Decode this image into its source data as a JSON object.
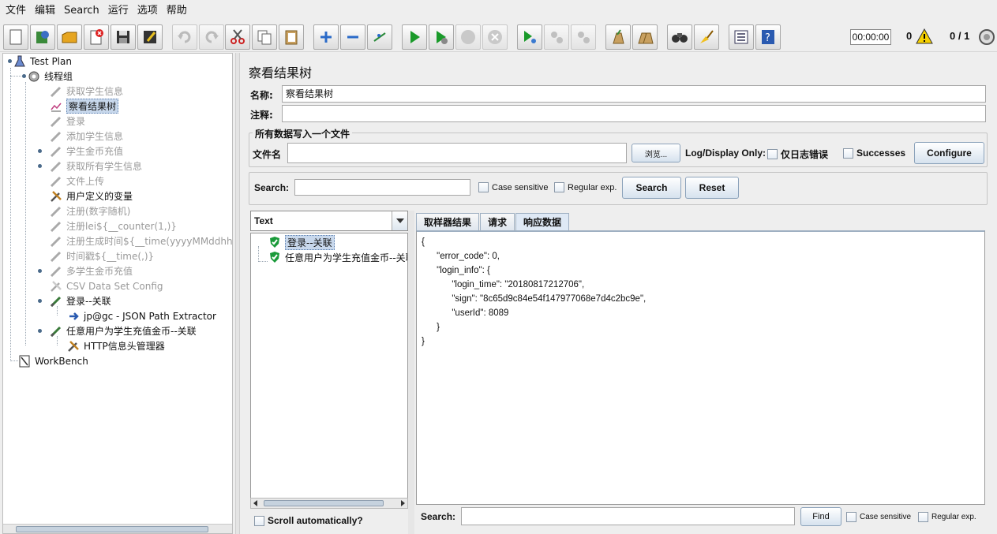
{
  "menubar": [
    "文件",
    "编辑",
    "Search",
    "运行",
    "选项",
    "帮助"
  ],
  "toolbar": {
    "buttons": [
      "new-icon",
      "templates-icon",
      "open-icon",
      "close-icon",
      "save-icon",
      "save-as-icon",
      "undo-icon",
      "redo-icon",
      "cut-icon",
      "copy-icon",
      "paste-icon",
      "expand-icon",
      "collapse-icon",
      "toggle-icon",
      "start-icon",
      "start-no-pause-icon",
      "stop-icon",
      "shutdown-icon",
      "remote-start-icon",
      "remote-stop-icon",
      "remote-shutdown-icon",
      "clear-icon",
      "clear-all-icon",
      "search-icon",
      "reset-search-icon",
      "function-helper-icon",
      "help-icon"
    ],
    "timer": "00:00:00",
    "warning_count": "0",
    "threads": "0 / 1"
  },
  "tree": {
    "items": [
      {
        "label": "Test Plan",
        "icon": "test-plan-icon"
      },
      {
        "label": "线程组",
        "icon": "thread-group-icon"
      },
      {
        "label": "获取学生信息",
        "icon": "sampler-icon"
      },
      {
        "label": "察看结果树",
        "icon": "listener-icon"
      },
      {
        "label": "登录",
        "icon": "sampler-icon"
      },
      {
        "label": "添加学生信息",
        "icon": "sampler-icon"
      },
      {
        "label": "学生金币充值",
        "icon": "sampler-icon"
      },
      {
        "label": "获取所有学生信息",
        "icon": "sampler-icon"
      },
      {
        "label": "文件上传",
        "icon": "sampler-icon"
      },
      {
        "label": "用户定义的变量",
        "icon": "config-icon"
      },
      {
        "label": "注册(数字随机)",
        "icon": "sampler-icon"
      },
      {
        "label": "注册lei${__counter(1,)}",
        "icon": "sampler-icon"
      },
      {
        "label": "注册生成时间${__time(yyyyMMddhhmm",
        "icon": "sampler-icon"
      },
      {
        "label": "时间戳${__time(,)}",
        "icon": "sampler-icon"
      },
      {
        "label": "多学生金币充值",
        "icon": "sampler-icon"
      },
      {
        "label": "CSV Data Set Config",
        "icon": "config-icon"
      },
      {
        "label": "登录--关联",
        "icon": "sampler-icon"
      },
      {
        "label": "jp@gc - JSON Path Extractor",
        "icon": "extractor-icon"
      },
      {
        "label": "任意用户为学生充值金币--关联",
        "icon": "sampler-icon"
      },
      {
        "label": "HTTP信息头管理器",
        "icon": "config-icon"
      },
      {
        "label": "WorkBench",
        "icon": "workbench-icon"
      }
    ]
  },
  "panel": {
    "title": "察看结果树",
    "name_label": "名称:",
    "name_value": "察看结果树",
    "comment_label": "注释:",
    "comment_value": "",
    "file_group_title": "所有数据写入一个文件",
    "file_label": "文件名",
    "file_value": "",
    "browse_label": "浏览...",
    "log_display_label": "Log/Display Only:",
    "errors_only_label": "仅日志错误",
    "successes_label": "Successes",
    "configure_label": "Configure",
    "search_label": "Search:",
    "search_value": "",
    "case_sensitive_label": "Case sensitive",
    "regex_label": "Regular exp.",
    "search_button": "Search",
    "reset_button": "Reset"
  },
  "results": {
    "renderer": "Text",
    "samples": [
      "登录--关联",
      "任意用户为学生充值金币--关联"
    ],
    "scroll_auto_label": "Scroll automatically?",
    "tabs": [
      "取样器结果",
      "请求",
      "响应数据"
    ],
    "active_tab": "响应数据",
    "response_body": "{\n      \"error_code\": 0,\n      \"login_info\": {\n            \"login_time\": \"20180817212706\",\n            \"sign\": \"8c65d9c84e54f147977068e7d4c2bc9e\",\n            \"userId\": 8089\n      }\n}",
    "bottom_search_label": "Search:",
    "bottom_search_value": "",
    "find_label": "Find",
    "bottom_case_label": "Case sensitive",
    "bottom_regex_label": "Regular exp."
  },
  "colors": {
    "selection": "#c8d8ec",
    "disabled_text": "#9a9a9a",
    "start_green": "#1a9a2a"
  }
}
